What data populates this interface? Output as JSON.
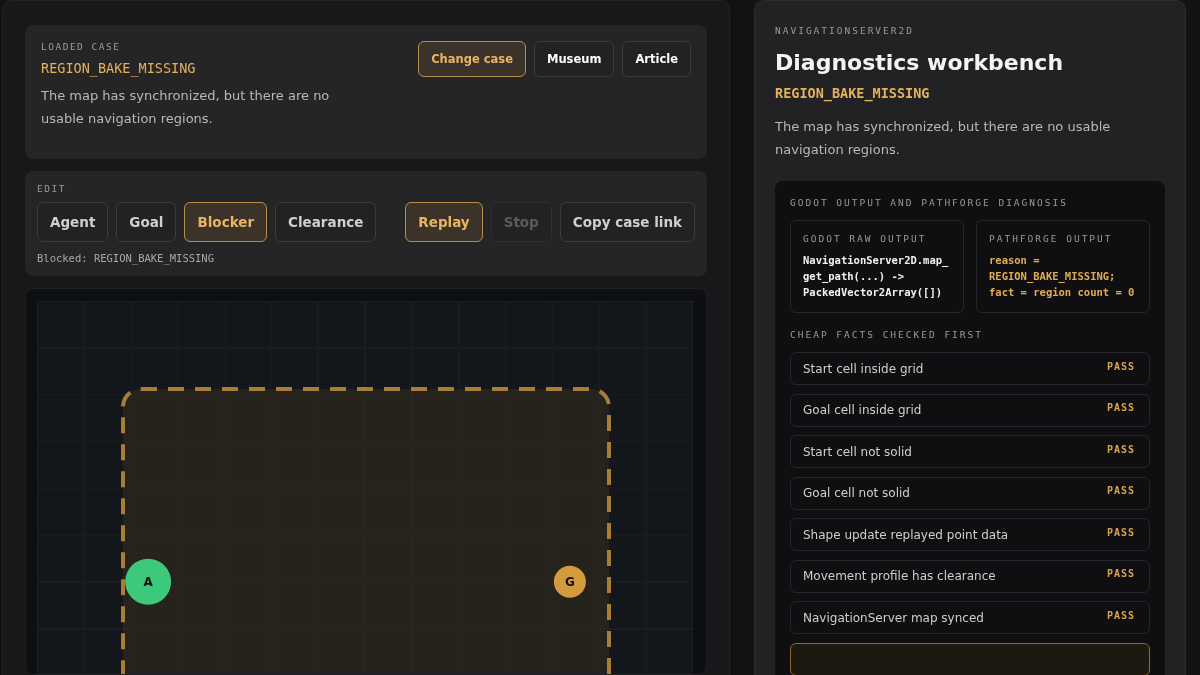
{
  "loaded_case": {
    "eyebrow": "LOADED CASE",
    "code": "REGION_BAKE_MISSING",
    "description": "The map has synchronized, but there are no usable navigation regions.",
    "buttons": [
      {
        "label": "Change case",
        "kind": "accent"
      },
      {
        "label": "Museum",
        "kind": "plain"
      },
      {
        "label": "Article",
        "kind": "plain"
      }
    ]
  },
  "edit": {
    "eyebrow": "EDIT",
    "tools": [
      {
        "label": "Agent",
        "selected": false
      },
      {
        "label": "Goal",
        "selected": false
      },
      {
        "label": "Blocker",
        "selected": true
      },
      {
        "label": "Clearance",
        "selected": false
      }
    ],
    "actions": [
      {
        "label": "Replay",
        "kind": "accent",
        "disabled": false
      },
      {
        "label": "Stop",
        "kind": "plain",
        "disabled": true
      },
      {
        "label": "Copy case link",
        "kind": "plain",
        "disabled": false
      }
    ],
    "status": "Blocked: REGION_BAKE_MISSING"
  },
  "map": {
    "markers": [
      {
        "kind": "agent",
        "label": "A"
      },
      {
        "kind": "goal",
        "label": "G"
      }
    ]
  },
  "workbench": {
    "eyebrow": "NAVIGATIONSERVER2D",
    "title": "Diagnostics workbench",
    "code": "REGION_BAKE_MISSING",
    "description": "The map has synchronized, but there are no usable navigation regions.",
    "diagnosis": {
      "heading": "GODOT OUTPUT AND PATHFORGE DIAGNOSIS",
      "outputs": [
        {
          "kind": "raw",
          "heading": "GODOT RAW OUTPUT",
          "lines": [
            "NavigationServer2D.map_",
            "get_path(...) ->",
            "PackedVector2Array([])"
          ]
        },
        {
          "kind": "diagnosis",
          "heading": "PATHFORGE OUTPUT",
          "lines": [
            "reason =",
            "REGION_BAKE_MISSING;",
            "fact = region count = 0"
          ]
        }
      ],
      "checks_heading": "CHEAP FACTS CHECKED FIRST",
      "checks": [
        {
          "label": "Start cell inside grid",
          "status": "PASS",
          "flagged": false
        },
        {
          "label": "Goal cell inside grid",
          "status": "PASS",
          "flagged": false
        },
        {
          "label": "Start cell not solid",
          "status": "PASS",
          "flagged": false
        },
        {
          "label": "Goal cell not solid",
          "status": "PASS",
          "flagged": false
        },
        {
          "label": "Shape update replayed point data",
          "status": "PASS",
          "flagged": false
        },
        {
          "label": "Movement profile has clearance",
          "status": "PASS",
          "flagged": false
        },
        {
          "label": "NavigationServer map synced",
          "status": "PASS",
          "flagged": false
        },
        {
          "flagged": true
        }
      ]
    }
  }
}
